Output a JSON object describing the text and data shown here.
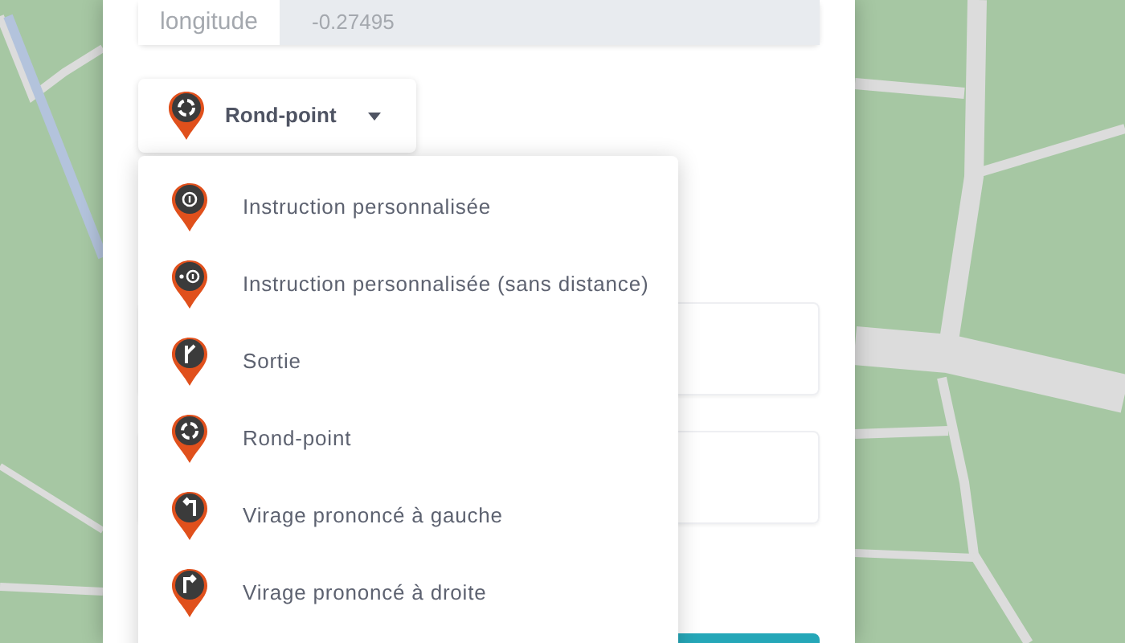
{
  "coordinates": {
    "label": "longitude",
    "value": "-0.27495"
  },
  "type_select": {
    "label": "Rond-point",
    "kind": "roundabout"
  },
  "menu": {
    "items": [
      {
        "label": "Instruction personnalisée",
        "kind": "info"
      },
      {
        "label": "Instruction personnalisée (sans distance)",
        "kind": "info_nodistance"
      },
      {
        "label": "Sortie",
        "kind": "exit"
      },
      {
        "label": "Rond-point",
        "kind": "roundabout"
      },
      {
        "label": "Virage prononcé à gauche",
        "kind": "sharp_left"
      },
      {
        "label": "Virage prononcé à droite",
        "kind": "sharp_right"
      }
    ]
  }
}
